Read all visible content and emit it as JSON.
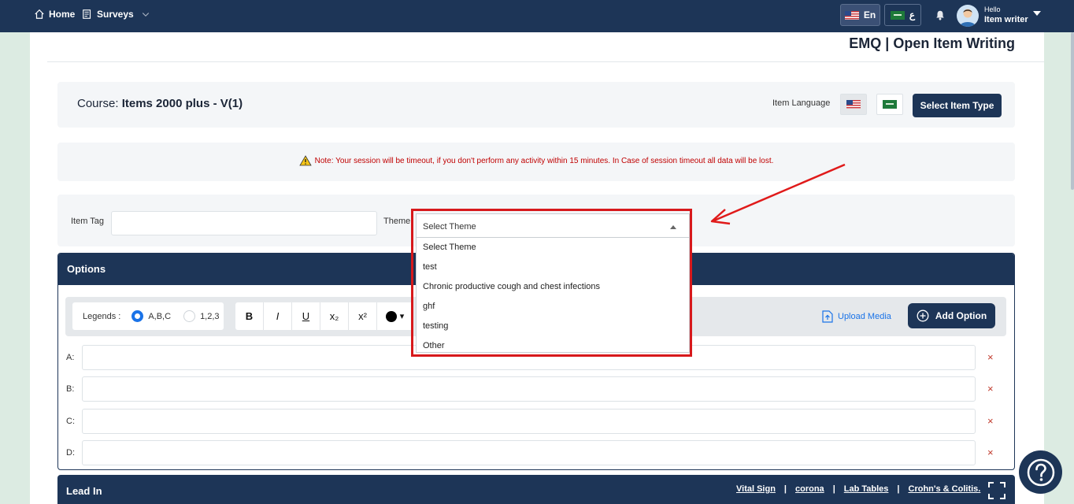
{
  "topbar": {
    "home_label": "Home",
    "surveys_label": "Surveys",
    "lang_en_label": "En",
    "lang_ar_label": "ع",
    "greeting": "Hello",
    "user_name": "Item writer"
  },
  "page": {
    "title": "EMQ | Open Item Writing"
  },
  "course": {
    "label": "Course:",
    "name": "Items 2000 plus - V(1)",
    "item_language_label": "Item Language",
    "select_item_type_label": "Select Item Type"
  },
  "note": {
    "text": "Note: Your session will be timeout, if you don't perform any activity within 15 minutes. In Case of session timeout all data will be lost."
  },
  "form": {
    "item_tag_label": "Item Tag",
    "item_tag_value": "",
    "theme_label": "Theme",
    "theme_selected": "Select Theme",
    "theme_options": [
      "Select Theme",
      "test",
      "Chronic productive cough and chest infections",
      "ghf",
      "testing",
      "Other"
    ]
  },
  "options": {
    "header": "Options",
    "legends_label": "Legends :",
    "legend_abc": "A,B,C",
    "legend_123": "1,2,3",
    "bold": "B",
    "italic": "I",
    "underline": "U",
    "subscript": "x₂",
    "superscript": "x²",
    "color_caret": "▾",
    "upload_media": "Upload Media",
    "add_option": "Add Option",
    "rows": [
      {
        "label": "A:",
        "value": ""
      },
      {
        "label": "B:",
        "value": ""
      },
      {
        "label": "C:",
        "value": ""
      },
      {
        "label": "D:",
        "value": ""
      }
    ],
    "remove_glyph": "×"
  },
  "leadin": {
    "title": "Lead In",
    "links": [
      "Vital Sign",
      "corona",
      "Lab Tables",
      "Crohn's & Colitis."
    ],
    "separator": "|"
  },
  "colors": {
    "navy": "#1d3557",
    "accent_blue": "#1a73e8",
    "alert_red": "#c00000",
    "highlight_red": "#d7191c"
  }
}
